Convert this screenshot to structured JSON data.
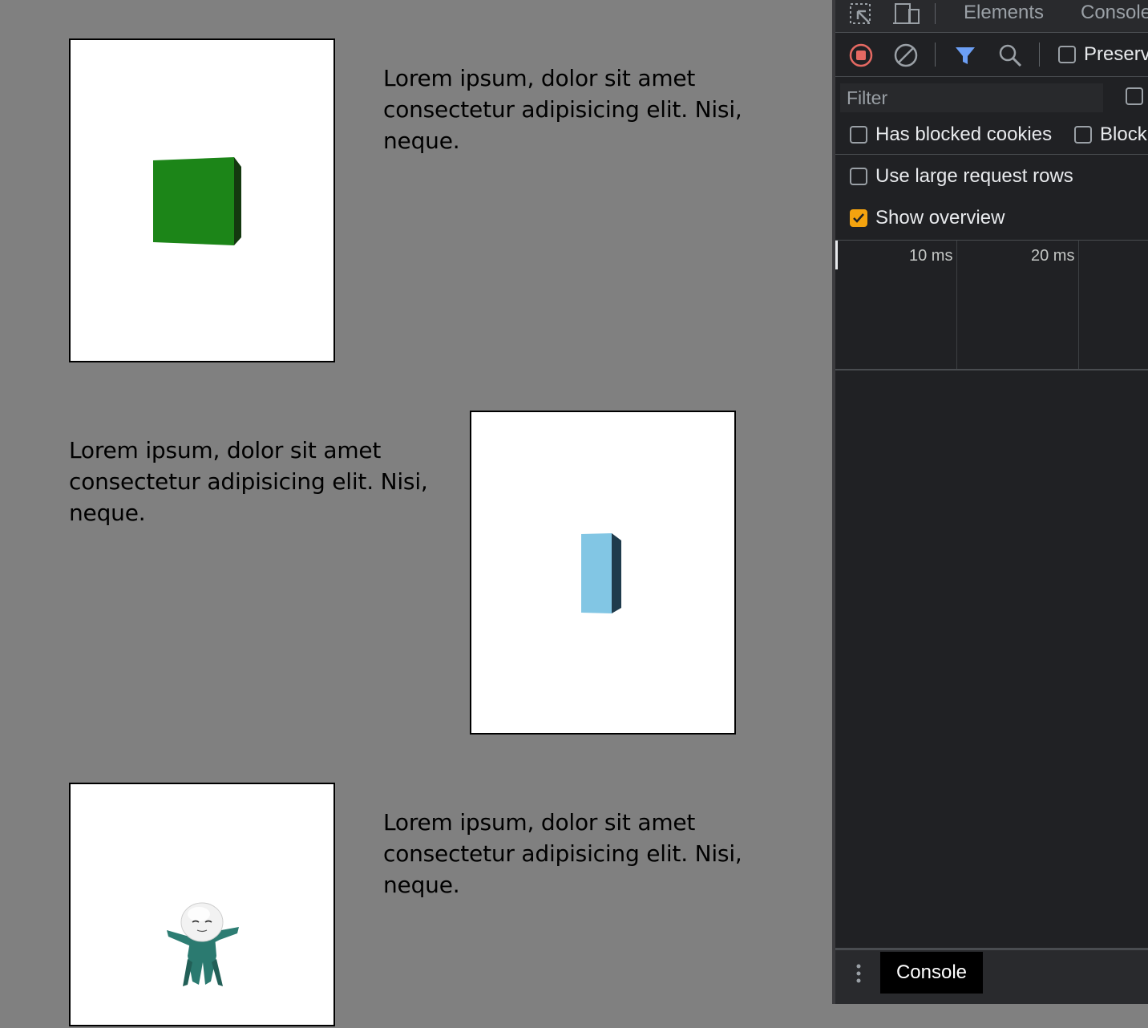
{
  "page": {
    "sections": [
      {
        "text": "Lorem ipsum, dolor sit amet consectetur adipisicing elit. Nisi, neque."
      },
      {
        "text": "Lorem ipsum, dolor sit amet consectetur adipisicing elit. Nisi, neque."
      },
      {
        "text": "Lorem ipsum, dolor sit amet consectetur adipisicing elit. Nisi, neque."
      }
    ],
    "colors": {
      "background": "#808080",
      "green_cube": "#1c8518",
      "blue_box": "#82c6e4",
      "character_body": "#2d7d73"
    }
  },
  "devtools": {
    "tabs": [
      "Elements",
      "Console"
    ],
    "toolbar": {
      "preserve_log_label": "Preserv",
      "icons": [
        "record-stop-icon",
        "clear-icon",
        "filter-icon",
        "search-icon"
      ]
    },
    "filter": {
      "placeholder": "Filter",
      "has_blocked_cookies_label": "Has blocked cookies",
      "blocked_label": "Block"
    },
    "settings": {
      "large_rows_label": "Use large request rows",
      "show_overview_label": "Show overview",
      "show_overview_checked": true
    },
    "overview": {
      "ticks": [
        "10 ms",
        "20 ms"
      ]
    },
    "drawer": {
      "console_tab": "Console"
    }
  }
}
